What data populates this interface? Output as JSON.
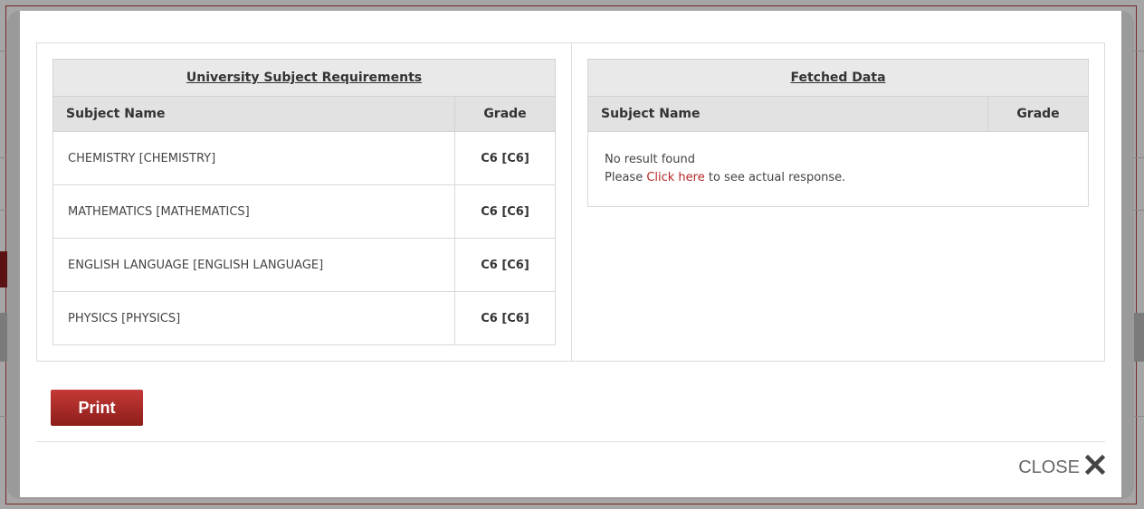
{
  "requirements": {
    "caption": "University Subject Requirements",
    "col_subject": "Subject Name",
    "col_grade": "Grade",
    "rows": [
      {
        "subject": "CHEMISTRY [CHEMISTRY]",
        "grade": "C6 [C6]"
      },
      {
        "subject": "MATHEMATICS [MATHEMATICS]",
        "grade": "C6 [C6]"
      },
      {
        "subject": "ENGLISH LANGUAGE [ENGLISH LANGUAGE]",
        "grade": "C6 [C6]"
      },
      {
        "subject": "PHYSICS [PHYSICS]",
        "grade": "C6 [C6]"
      }
    ]
  },
  "fetched": {
    "caption": "Fetched Data",
    "col_subject": "Subject Name",
    "col_grade": "Grade",
    "no_result": "No result found",
    "please": "Please",
    "click_here": "Click here",
    "response_text": "to see actual response."
  },
  "actions": {
    "print_label": "Print",
    "close_label": "CLOSE"
  },
  "icons": {
    "close": "close-icon"
  },
  "colors": {
    "accent": "#a82a26",
    "link": "#b52626"
  }
}
